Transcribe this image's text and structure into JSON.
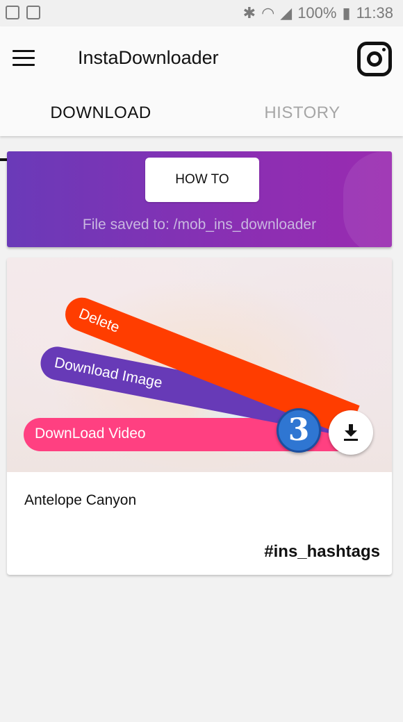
{
  "status_bar": {
    "battery": "100%",
    "time": "11:38",
    "icons": [
      "gallery-icon",
      "screenshot-icon",
      "bluetooth-icon",
      "wifi-icon",
      "signal-icon",
      "battery-icon"
    ]
  },
  "app": {
    "title": "InstaDownloader",
    "menu_icon": "hamburger-menu-icon",
    "action_icon": "instagram-icon"
  },
  "tabs": [
    {
      "label": "DOWNLOAD",
      "active": true
    },
    {
      "label": "HISTORY",
      "active": false
    }
  ],
  "banner": {
    "button_label": "HOW TO",
    "save_path": "File saved to: /mob_ins_downloader",
    "gradient": [
      "#6a3ab8",
      "#9a2bb0"
    ]
  },
  "post": {
    "caption": "Antelope Canyon",
    "hashtag": "#ins_hashtags",
    "fan_menu": [
      {
        "label": "Delete",
        "color": "#ff3d00"
      },
      {
        "label": "Download Image",
        "color": "#673ab7"
      },
      {
        "label": "DownLoad Video",
        "color": "#ff4081"
      }
    ],
    "badge": "3",
    "fab_icon": "download-icon"
  }
}
